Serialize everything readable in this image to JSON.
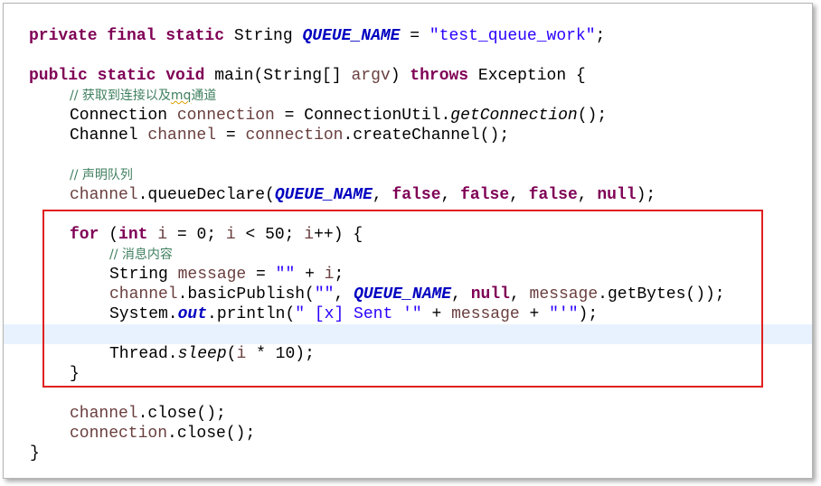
{
  "code": {
    "l1": {
      "kw1": "private final static",
      "t1": " String ",
      "fld": "QUEUE_NAME",
      "t2": " = ",
      "str": "\"test_queue_work\"",
      "t3": ";"
    },
    "l2": {
      "kw1": "public static void",
      "t1": " main(String[] ",
      "var": "argv",
      "t2": ") ",
      "kw2": "throws",
      "t3": " Exception {"
    },
    "l3": {
      "comment": "// 获取到连接以及",
      "squig": "mq",
      "comment2": "通道"
    },
    "l4": {
      "t1": "Connection ",
      "var": "connection",
      "t2": " = ConnectionUtil.",
      "it": "getConnection",
      "t3": "();"
    },
    "l5": {
      "t1": "Channel ",
      "var1": "channel",
      "t2": " = ",
      "var2": "connection",
      "t3": ".createChannel();"
    },
    "l6": {
      "comment": "// 声明队列"
    },
    "l7": {
      "var": "channel",
      "t1": ".queueDeclare(",
      "fld": "QUEUE_NAME",
      "t2": ", ",
      "kw1": "false",
      "t3": ", ",
      "kw2": "false",
      "t4": ", ",
      "kw3": "false",
      "t5": ", ",
      "kw4": "null",
      "t6": ");"
    },
    "l8": {
      "kw1": "for",
      "t1": " (",
      "kw2": "int",
      "t2": " ",
      "var1": "i",
      "t3": " = 0; ",
      "var2": "i",
      "t4": " < 50; ",
      "var3": "i",
      "t5": "++) {"
    },
    "l9": {
      "comment": "// 消息内容"
    },
    "l10": {
      "t1": "String ",
      "var1": "message",
      "t2": " = ",
      "str": "\"\"",
      "t3": " + ",
      "var2": "i",
      "t4": ";"
    },
    "l11": {
      "var1": "channel",
      "t1": ".basicPublish(",
      "str": "\"\"",
      "t2": ", ",
      "fld": "QUEUE_NAME",
      "t3": ", ",
      "kw": "null",
      "t4": ", ",
      "var2": "message",
      "t5": ".getBytes());"
    },
    "l12": {
      "t1": "System.",
      "fld": "out",
      "t2": ".println(",
      "str1": "\" [x] Sent '\"",
      "t3": " + ",
      "var": "message",
      "t4": " + ",
      "str2": "\"'\"",
      "t5": ");"
    },
    "l13": {
      "t1": "Thread.",
      "it": "sleep",
      "t2": "(",
      "var": "i",
      "t3": " * 10);"
    },
    "l14": {
      "t1": "}"
    },
    "l15": {
      "var": "channel",
      "t1": ".close();"
    },
    "l16": {
      "var": "connection",
      "t1": ".close();"
    },
    "l17": {
      "t1": "}"
    }
  }
}
